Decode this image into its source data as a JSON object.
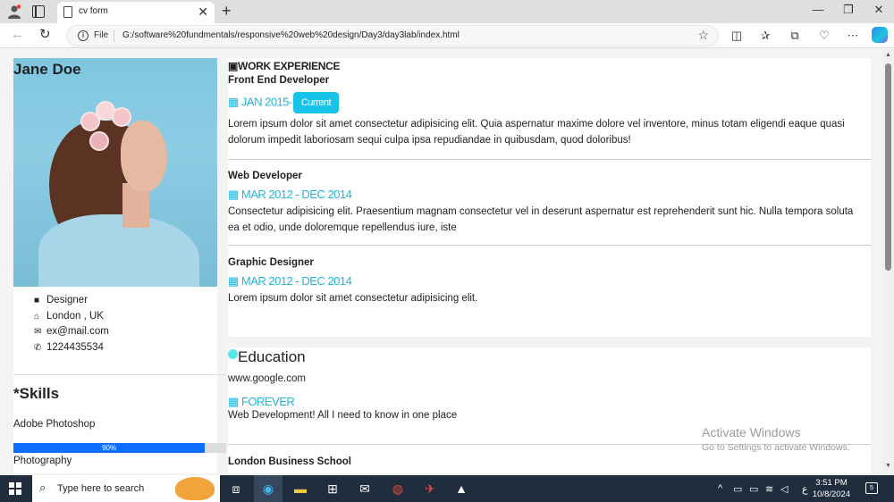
{
  "browser": {
    "tab_title": "cv form",
    "url_scheme": "File",
    "url": "G:/software%20fundmentals/responsive%20web%20design/Day3/day3lab/index.html"
  },
  "sidebar": {
    "name": "Jane Doe",
    "info": [
      {
        "icon": "briefcase-icon",
        "text": "Designer"
      },
      {
        "icon": "home-icon",
        "text": "London , UK"
      },
      {
        "icon": "envelope-icon",
        "text": "ex@mail.com"
      },
      {
        "icon": "phone-icon",
        "text": "1224435534"
      }
    ],
    "skills_title": "Skills",
    "skills": [
      {
        "name": "Adobe Photoshop",
        "percent_label": "90%",
        "percent": 90
      },
      {
        "name": "Photography"
      }
    ]
  },
  "work": {
    "title": "WORK EXPERIENCE",
    "jobs": [
      {
        "title": "Front End Developer",
        "date": "JAN 2015-",
        "badge": "Current",
        "desc": "Lorem ipsum dolor sit amet consectetur adipisicing elit. Quia aspernatur maxime dolore vel inventore, minus totam eligendi eaque quasi dolorum impedit laboriosam sequi culpa ipsa repudiandae in quibusdam, quod doloribus!"
      },
      {
        "title": "Web Developer",
        "date": "MAR 2012 - DEC 2014",
        "desc": "Consectetur adipisicing elit. Praesentium magnam consectetur vel in deserunt aspernatur est reprehenderit sunt hic. Nulla tempora soluta ea et odio, unde doloremque repellendus iure, iste"
      },
      {
        "title": "Graphic Designer",
        "date": "MAR 2012 - DEC 2014",
        "desc": "Lorem ipsum dolor sit amet consectetur adipisicing elit."
      }
    ]
  },
  "education": {
    "title": "Education",
    "site": "www.google.com",
    "date": "FOREVER",
    "desc": "Web Development! All I need to know in one place",
    "next_school": "London Business School"
  },
  "watermark": {
    "line1": "Activate Windows",
    "line2": "Go to Settings to activate Windows."
  },
  "taskbar": {
    "search_placeholder": "Type here to search",
    "time": "3:51 PM",
    "date": "10/8/2024",
    "lang": "ع",
    "notifications": "5"
  },
  "colors": {
    "accent": "#1fb6d9",
    "badge": "#17c3e8",
    "progress": "#0d6efd"
  }
}
